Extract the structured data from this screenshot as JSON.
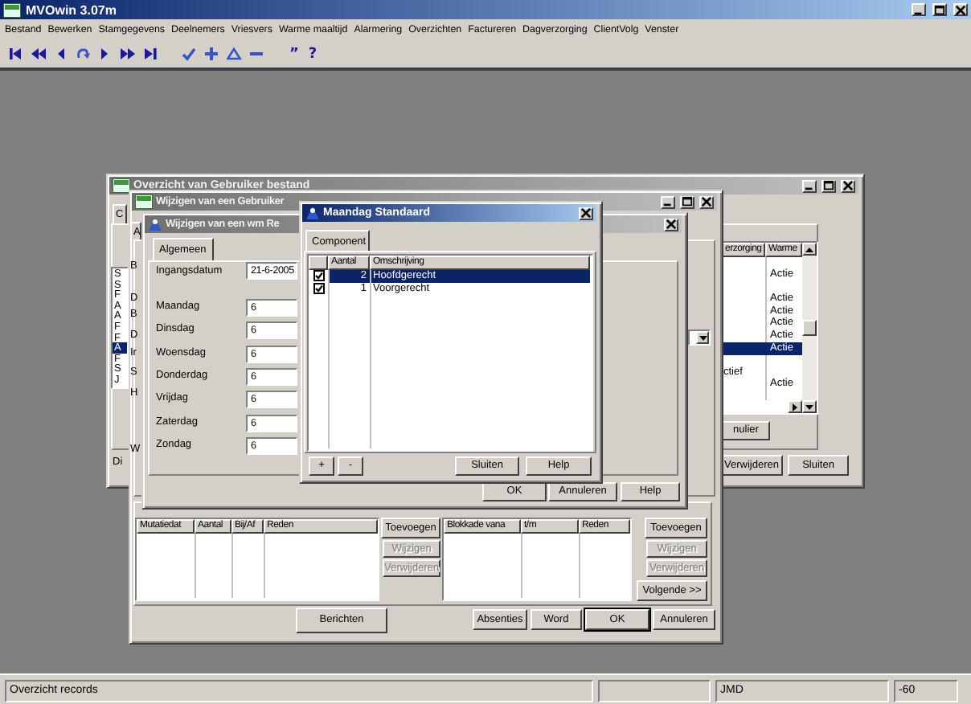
{
  "window": {
    "title": "MVOwin 3.07m"
  },
  "menu": [
    "Bestand",
    "Bewerken",
    "Stamgegevens",
    "Deelnemers",
    "Vriesvers",
    "Warme maaltijd",
    "Alarmering",
    "Overzichten",
    "Factureren",
    "Dagverzorging",
    "ClientVolg",
    "Venster"
  ],
  "toolbar_glyphs": [
    "”",
    "?"
  ],
  "overview": {
    "title": "Overzicht van Gebruiker bestand",
    "tab": "C",
    "label": "Di",
    "list": [
      {
        "text": "S",
        "selected": false
      },
      {
        "text": "S",
        "selected": false
      },
      {
        "text": "F",
        "selected": false
      },
      {
        "text": "A",
        "selected": false
      },
      {
        "text": "A",
        "selected": false
      },
      {
        "text": "F",
        "selected": false
      },
      {
        "text": "F",
        "selected": false
      },
      {
        "text": "A",
        "selected": true
      },
      {
        "text": "F",
        "selected": false
      },
      {
        "text": "S",
        "selected": false
      },
      {
        "text": "J",
        "selected": false
      }
    ],
    "table": {
      "columns": [
        "erzorging",
        "Warme"
      ],
      "rows": [
        {
          "cells": [
            "",
            "Actie"
          ],
          "selected": false
        },
        {
          "cells": [
            "",
            ""
          ],
          "selected": false
        },
        {
          "cells": [
            "",
            "Actie"
          ],
          "selected": false
        },
        {
          "cells": [
            "",
            "Actie"
          ],
          "selected": false
        },
        {
          "cells": [
            "",
            "Actie"
          ],
          "selected": false
        },
        {
          "cells": [
            "",
            "Actie"
          ],
          "selected": false
        },
        {
          "cells": [
            "",
            "Actie"
          ],
          "selected": true
        },
        {
          "cells": [
            "",
            ""
          ],
          "selected": false
        },
        {
          "cells": [
            "ctief",
            ""
          ],
          "selected": false
        },
        {
          "cells": [
            "",
            "Actie"
          ],
          "selected": false
        }
      ]
    },
    "buttons": [
      "nulier",
      "Verwijderen",
      "Sluiten"
    ]
  },
  "user_edit": {
    "title": "Wijzigen van een Gebruiker",
    "tab": "A",
    "labels": [
      "B",
      "D",
      "B",
      "D",
      "Ir",
      "S",
      "H",
      "W"
    ],
    "mutations": {
      "columns": [
        "Mutatiedat",
        "Aantal",
        "Bij/Af",
        "Reden"
      ],
      "buttons": [
        {
          "label": "Toevoegen",
          "disabled": false
        },
        {
          "label": "Wijzigen",
          "disabled": true
        },
        {
          "label": "Verwijderen",
          "disabled": true
        }
      ]
    },
    "blocks": {
      "columns": [
        "Blokkade vana",
        "t/m",
        "Reden"
      ],
      "buttons": [
        {
          "label": "Toevoegen",
          "disabled": false
        },
        {
          "label": "Wijzigen",
          "disabled": true
        },
        {
          "label": "Verwijderen",
          "disabled": true
        },
        {
          "label": "Volgende >>",
          "disabled": false
        }
      ]
    },
    "buttons": [
      "Berichten",
      "Absenties",
      "Word",
      "OK",
      "Annuleren"
    ]
  },
  "meal_edit": {
    "title": "Wijzigen van een wm Re",
    "tabs": [
      {
        "label": "Algemeen",
        "selected": true
      }
    ],
    "start_date": {
      "label": "Ingangsdatum",
      "value": "21-6-2005"
    },
    "days": [
      {
        "label": "Maandag",
        "value": "6"
      },
      {
        "label": "Dinsdag",
        "value": "6"
      },
      {
        "label": "Woensdag",
        "value": "6"
      },
      {
        "label": "Donderdag",
        "value": "6"
      },
      {
        "label": "Vrijdag",
        "value": "6"
      },
      {
        "label": "Zaterdag",
        "value": "6"
      },
      {
        "label": "Zondag",
        "value": "6"
      }
    ],
    "buttons": [
      "OK",
      "Annuleren",
      "Help"
    ]
  },
  "monday_standard": {
    "title": "Maandag Standaard",
    "tabs": [
      {
        "label": "Component",
        "selected": true
      }
    ],
    "columns": [
      "Aantal",
      "Omschrijving"
    ],
    "rows": [
      {
        "checked": true,
        "amount": "2",
        "description": "Hoofdgerecht",
        "selected": true
      },
      {
        "checked": true,
        "amount": "1",
        "description": "Voorgerecht",
        "selected": false
      }
    ],
    "buttons": [
      "+",
      "-",
      "Sluiten",
      "Help"
    ]
  },
  "status_bar": [
    "Overzicht records",
    "JMD",
    "-60"
  ]
}
